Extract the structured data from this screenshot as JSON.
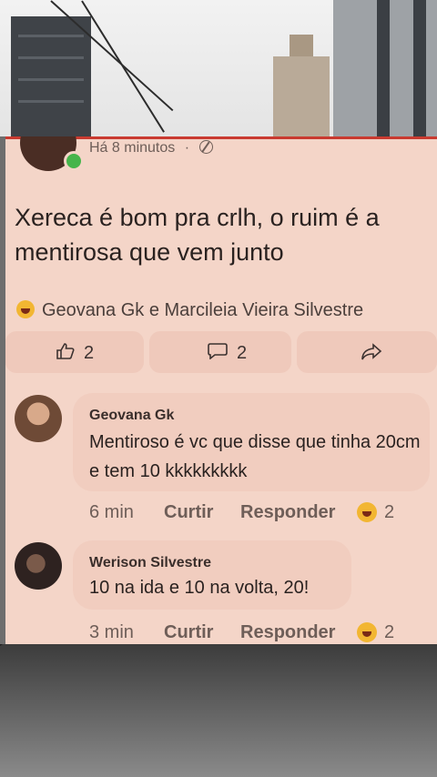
{
  "post": {
    "time": "Há 8 minutos",
    "separator": "·",
    "text": "Xereca é bom pra crlh, o ruim é a mentirosa que vem junto",
    "reactors": "Geovana Gk e Marcileia Vieira Silvestre",
    "likes": "2",
    "comments": "2"
  },
  "comments": [
    {
      "author": "Geovana Gk",
      "text": "Mentiroso é vc que disse que tinha 20cm e tem 10 kkkkkkkkk",
      "time": "6 min",
      "like_label": "Curtir",
      "reply_label": "Responder",
      "reactions": "2"
    },
    {
      "author": "Werison Silvestre",
      "text": "10 na ida e 10 na volta, 20!",
      "time": "3 min",
      "like_label": "Curtir",
      "reply_label": "Responder",
      "reactions": "2"
    }
  ],
  "colors": {
    "card_bg": "#f4d5c8",
    "bubble_bg": "#f1cdbf",
    "accent_line": "#c93a30",
    "online": "#46b54b"
  },
  "icons": [
    "globe-icon",
    "laugh-reaction-icon",
    "like-icon",
    "comment-icon",
    "share-icon"
  ]
}
